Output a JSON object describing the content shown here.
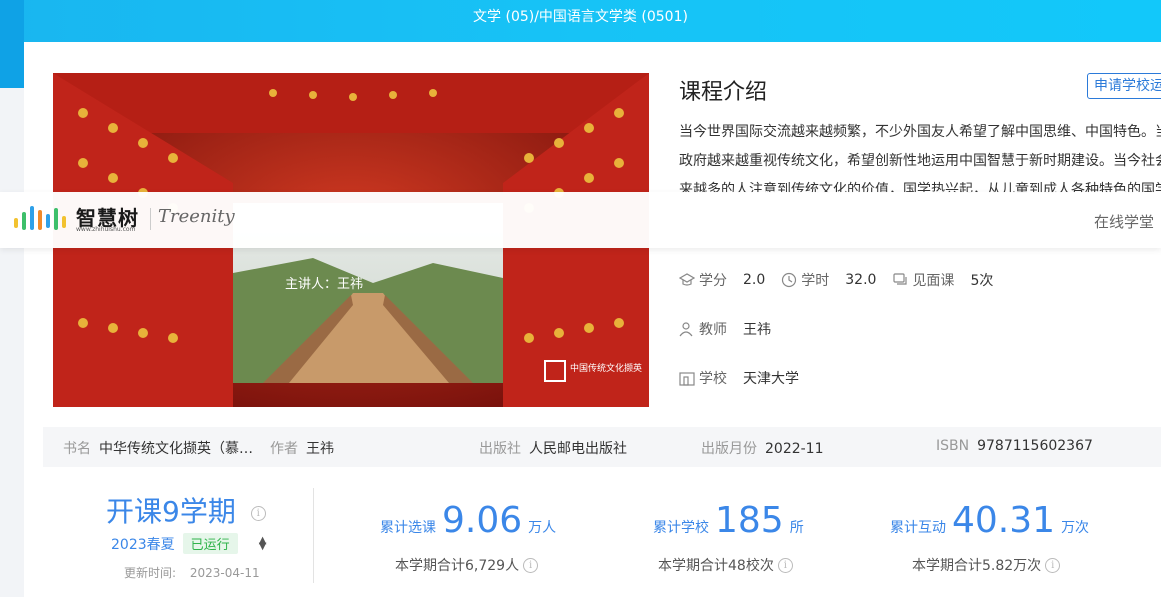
{
  "header": {
    "category": "文学 (05)/中国语言文学类 (0501)"
  },
  "cover": {
    "host_text": "主讲人：王祎",
    "seal_text": "中国传统文化撷英"
  },
  "intro": {
    "title": "课程介绍",
    "apply_button": "申请学校运",
    "lines": [
      "当今世界国际交流越来越频繁，不少外国友人希望了解中国思维、中国特色。当",
      "政府越来越重视传统文化，希望创新性地运用中国智慧于新时期建设。当今社会",
      "来越多的人注意到传统文化的价值，国学热兴起，从儿童到成人各种特色的国学"
    ]
  },
  "nav": {
    "logo_cn": "智慧树",
    "logo_url": "www.zhihuishu.com",
    "logo_en": "Treenity",
    "link": "在线学堂"
  },
  "meta": {
    "credit_label": "学分",
    "credit_value": "2.0",
    "hours_label": "学时",
    "hours_value": "32.0",
    "meet_label": "见面课",
    "meet_value": "5次",
    "teacher_label": "教师",
    "teacher_value": "王祎",
    "school_label": "学校",
    "school_value": "天津大学"
  },
  "book": {
    "name_label": "书名",
    "name_value": "中华传统文化撷英（慕…",
    "author_label": "作者",
    "author_value": "王祎",
    "publisher_label": "出版社",
    "publisher_value": "人民邮电出版社",
    "date_label": "出版月份",
    "date_value": "2022-11",
    "isbn_label": "ISBN",
    "isbn_value": "9787115602367"
  },
  "term": {
    "title": "开课9学期",
    "season": "2023春夏",
    "status": "已运行",
    "update_label": "更新时间:",
    "update_value": "2023-04-11"
  },
  "stats": {
    "select": {
      "label": "累计选课",
      "value": "9.06",
      "unit": "万人",
      "sub": "本学期合计6,729人"
    },
    "school": {
      "label": "累计学校",
      "value": "185",
      "unit": "所",
      "sub": "本学期合计48校次"
    },
    "interact": {
      "label": "累计互动",
      "value": "40.31",
      "unit": "万次",
      "sub": "本学期合计5.82万次"
    }
  },
  "colors": {
    "accent": "#3b87e8",
    "header": "#17c3f6",
    "status_green": "#2fb34a"
  }
}
